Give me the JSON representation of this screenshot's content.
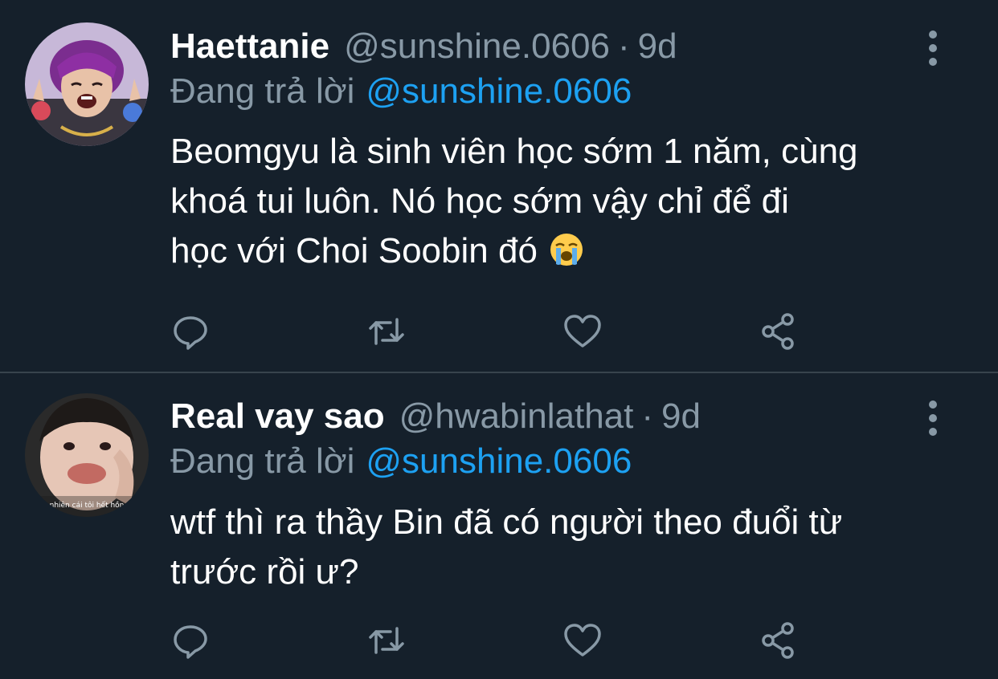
{
  "tweets": [
    {
      "display_name": "Haettanie",
      "handle": "@sunshine.0606",
      "separator": "·",
      "time": "9d",
      "reply_prefix": "Đang trả lời",
      "reply_to": "@sunshine.0606",
      "body_lines": [
        "Beomgyu là sinh viên học sớm 1 năm, cùng",
        "khoá tui luôn. Nó học sớm vậy chỉ để đi",
        "học với Choi Soobin đó"
      ],
      "emoji": "loudly-crying-face"
    },
    {
      "display_name": "Real vay sao",
      "handle": "@hwabinlathat",
      "separator": "·",
      "time": "9d",
      "reply_prefix": "Đang trả lời",
      "reply_to": "@sunshine.0606",
      "body_lines": [
        "wtf thì ra thầy Bin đã có người theo đuổi từ",
        "trước rồi ư?"
      ],
      "avatar_caption": "nhiên cái tôi hết hồn"
    }
  ],
  "colors": {
    "background": "#15202b",
    "text_primary": "#ffffff",
    "text_secondary": "#8899a6",
    "link": "#1da1f2",
    "divider": "#38444d"
  },
  "icons": [
    "reply-icon",
    "retweet-icon",
    "like-icon",
    "share-icon",
    "more-options-icon"
  ]
}
